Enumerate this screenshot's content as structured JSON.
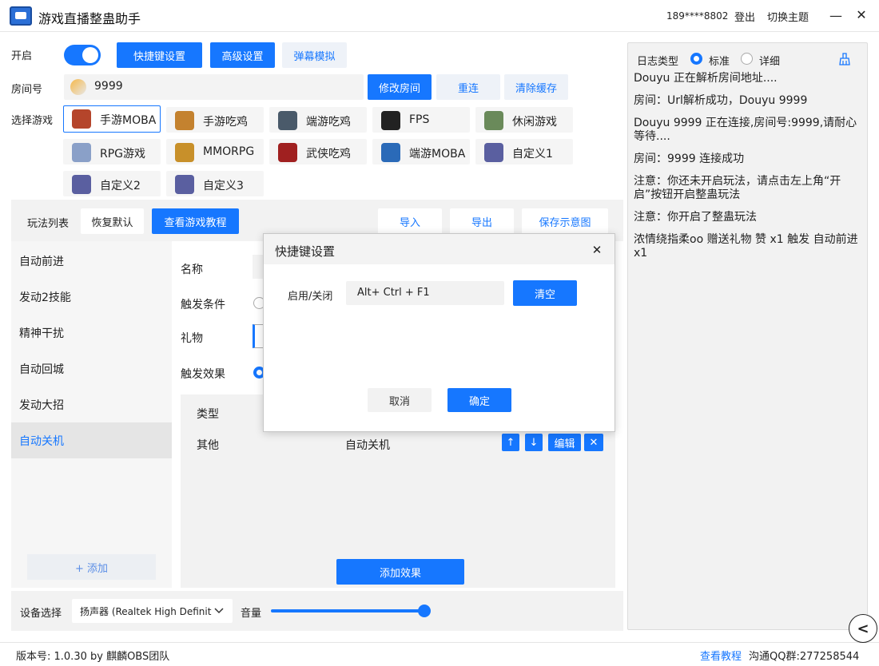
{
  "window": {
    "title": "游戏直播整蛊助手",
    "account": "189****8802",
    "logout": "登出",
    "switch_theme": "切换主题",
    "minimize": "—",
    "close": "✕"
  },
  "controls": {
    "enable_label": "开启",
    "hotkey_button": "快捷键设置",
    "advanced_button": "高级设置",
    "danmaku_button": "弹幕模拟",
    "room_label": "房间号",
    "room_value": "9999",
    "edit_room_button": "修改房间",
    "reconnect_button": "重连",
    "clear_cache_button": "清除缓存",
    "select_game_label": "选择游戏"
  },
  "games": [
    {
      "label": "手游MOBA",
      "icon": "moba-hero-icon",
      "color": "#b5452b"
    },
    {
      "label": "手游吃鸡",
      "icon": "mobile-pubg-icon",
      "color": "#c4822f"
    },
    {
      "label": "端游吃鸡",
      "icon": "pubg-icon",
      "color": "#4a5a6a"
    },
    {
      "label": "FPS",
      "icon": "cs-icon",
      "color": "#222222"
    },
    {
      "label": "休闲游戏",
      "icon": "casual-game-icon",
      "color": "#6a8a5a"
    },
    {
      "label": "RPG游戏",
      "icon": "rpg-character-icon",
      "color": "#8aa0c8"
    },
    {
      "label": "MMORPG",
      "icon": "wow-icon",
      "color": "#c8902a"
    },
    {
      "label": "武侠吃鸡",
      "icon": "wuxia-icon",
      "color": "#a02020"
    },
    {
      "label": "端游MOBA",
      "icon": "lol-icon",
      "color": "#2a6ab8"
    },
    {
      "label": "自定义1",
      "icon": "start-game-icon",
      "color": "#5a5fa0"
    },
    {
      "label": "自定义2",
      "icon": "start-game-icon",
      "color": "#5a5fa0"
    },
    {
      "label": "自定义3",
      "icon": "start-game-icon",
      "color": "#5a5fa0"
    }
  ],
  "play": {
    "list_label": "玩法列表",
    "restore_default": "恢复默认",
    "view_tutorial": "查看游戏教程",
    "import": "导入",
    "export": "导出",
    "save_diagram": "保存示意图",
    "items": [
      "自动前进",
      "发动2技能",
      "精神干扰",
      "自动回城",
      "发动大招",
      "自动关机"
    ],
    "add": "+ 添加",
    "field_name": "名称",
    "field_trigger": "触发条件",
    "field_gift": "礼物",
    "field_effect": "触发效果",
    "table_type_header": "类型",
    "row_type": "其他",
    "row_name": "自动关机",
    "edit": "编辑",
    "up": "↑",
    "down": "↓",
    "remove": "✕",
    "add_effect": "添加效果"
  },
  "device": {
    "label": "设备选择",
    "selected": "扬声器 (Realtek High Definit",
    "volume_label": "音量",
    "volume": 1.0
  },
  "log": {
    "type_label": "日志类型",
    "standard": "标准",
    "detail": "详细",
    "clean_icon": "broom-icon",
    "lines": [
      "Douyu    正在解析房间地址....",
      "房间：Url解析成功，Douyu 9999",
      "Douyu  9999 正在连接,房间号:9999,请耐心等待....",
      "房间：9999 连接成功",
      "注意：你还未开启玩法，请点击左上角“开启”按钮开启整蛊玩法",
      "注意：你开启了整蛊玩法",
      "浓情绕指柔oo 赠送礼物 赞 x1 触发 自动前进 x1"
    ]
  },
  "status": {
    "version": "版本号: 1.0.30 by 麒麟OBS团队",
    "tutorial_link": "查看教程",
    "qq_group": "沟通QQ群:277258544"
  },
  "modal": {
    "title": "快捷键设置",
    "close": "✕",
    "toggle_label": "启用/关闭",
    "hotkey_value": "Alt+ Ctrl + F1",
    "clear": "清空",
    "cancel": "取消",
    "confirm": "确定"
  },
  "collapse_button": "<",
  "colors": {
    "accent": "#1677ff",
    "panel_bg": "#f2f2f2"
  }
}
